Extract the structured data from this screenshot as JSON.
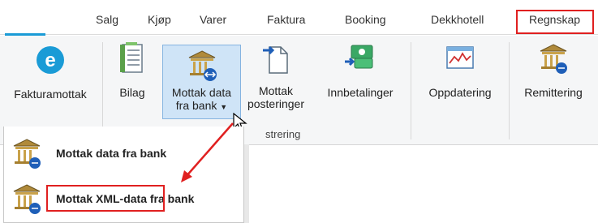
{
  "tabs": [
    {
      "label": "Salg"
    },
    {
      "label": "Kjøp"
    },
    {
      "label": "Varer"
    },
    {
      "label": "Faktura"
    },
    {
      "label": "Booking"
    },
    {
      "label": "Dekkhotell"
    },
    {
      "label": "Regnskap",
      "active": true
    }
  ],
  "ribbon": {
    "fakturamottak": "Fakturamottak",
    "bilag": "Bilag",
    "mottak_data_line1": "Mottak data",
    "mottak_data_line2": "fra bank",
    "mottak_posteringer_line1": "Mottak",
    "mottak_posteringer_line2": "posteringer",
    "innbetalinger": "Innbetalinger",
    "oppdatering": "Oppdatering",
    "remittering": "Remittering",
    "group_label": "strering"
  },
  "dropdown": {
    "items": [
      {
        "label": "Mottak data fra bank"
      },
      {
        "label": "Mottak XML-data fra bank"
      }
    ]
  },
  "colors": {
    "highlight_red": "#e02020",
    "hover_blue": "#cfe4f7",
    "accent_teal": "#1a9bd6"
  }
}
